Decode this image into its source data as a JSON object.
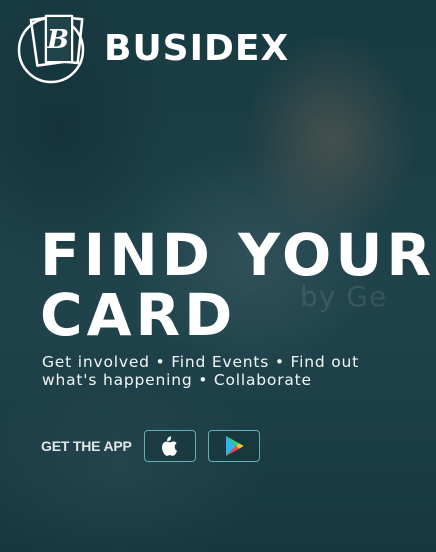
{
  "brand": {
    "name": "BUSIDEX"
  },
  "hero": {
    "headline_line1": "FIND YOUR",
    "headline_line2": "CARD",
    "tagline_line1": "Get involved • Find Events • Find out",
    "tagline_line2": "what's happening  • Collaborate",
    "background_text": "by Ge"
  },
  "app": {
    "label": "GET THE APP",
    "stores": [
      {
        "name": "App Store",
        "icon": "apple-icon"
      },
      {
        "name": "Google Play",
        "icon": "google-play-icon"
      }
    ]
  },
  "colors": {
    "overlay": "#1f3e45",
    "text": "#ffffff",
    "button_border": "#5fb0b8"
  }
}
